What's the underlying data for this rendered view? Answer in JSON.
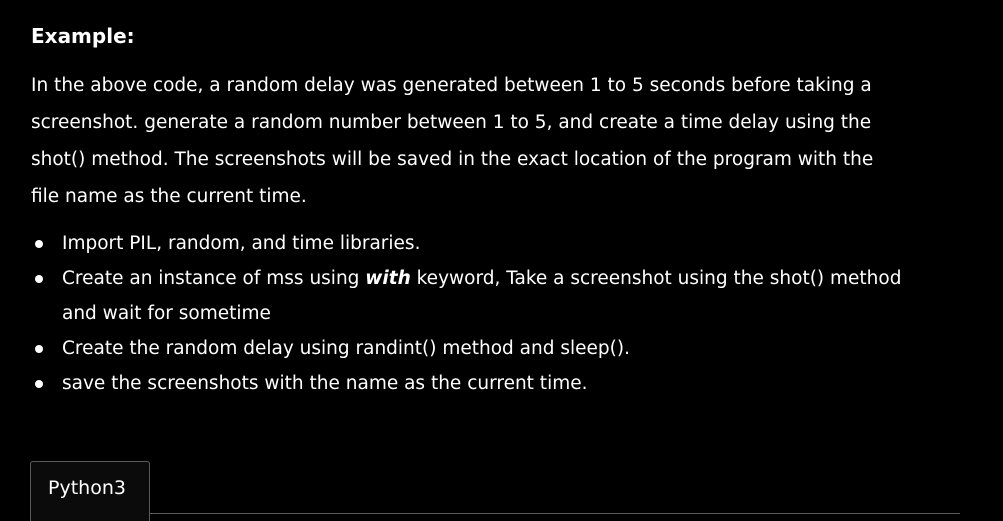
{
  "heading": "Example:",
  "paragraph": {
    "lines": [
      "In the above code, a random delay was generated between 1 to 5 seconds before taking a",
      "screenshot. generate a random number between 1 to 5, and create a time delay using the",
      "shot() method. The screenshots will be saved in the exact location of the program with the",
      "file name as the current time."
    ]
  },
  "bullets": {
    "item1": "Import PIL, random, and time libraries.",
    "item2": {
      "before": "Create an instance of mss using ",
      "keyword": "with",
      "after": " keyword, Take a screenshot using the shot() method",
      "line2": "and wait for sometime"
    },
    "item3": "Create the random delay using randint() method and sleep().",
    "item4": "save the screenshots with the name as the current time."
  },
  "code_tab": {
    "label": "Python3"
  },
  "colors": {
    "background": "#000000",
    "text": "#ffffff",
    "border": "#5a5a5a"
  }
}
